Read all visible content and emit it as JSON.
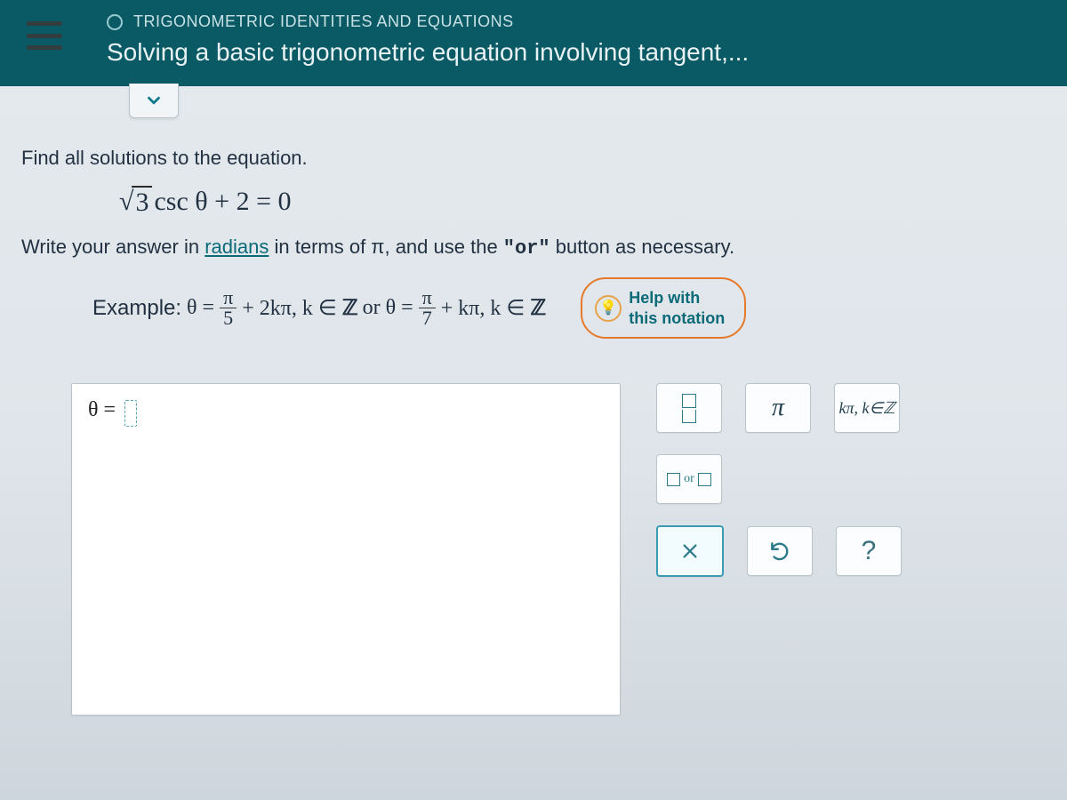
{
  "header": {
    "breadcrumb": "TRIGONOMETRIC IDENTITIES AND EQUATIONS",
    "title": "Solving a basic trigonometric equation involving tangent,..."
  },
  "problem": {
    "prompt": "Find all solutions to the equation.",
    "equation": {
      "radicand": "3",
      "rest": " csc θ + 2 = 0"
    },
    "instruction_pre": "Write your answer in ",
    "instruction_link": "radians",
    "instruction_mid": " in terms of π, and use the ",
    "instruction_quote": "\"or\"",
    "instruction_post": " button as necessary."
  },
  "example": {
    "label": "Example: ",
    "lhs": "θ =",
    "frac1_num": "π",
    "frac1_den": "5",
    "term1": " + 2kπ, k ∈ ",
    "z1": "ℤ",
    "or": " or ",
    "lhs2": "θ =",
    "frac2_num": "π",
    "frac2_den": "7",
    "term2": " + kπ, k ∈ ",
    "z2": "ℤ"
  },
  "help_pill": {
    "line1": "Help with",
    "line2": "this notation"
  },
  "answer": {
    "prefix": "θ ="
  },
  "keypad": {
    "fraction_aria": "fraction",
    "pi": "π",
    "kz": "kπ, k∈ℤ",
    "or_text": "or",
    "clear_aria": "clear",
    "undo_aria": "undo",
    "help": "?"
  }
}
